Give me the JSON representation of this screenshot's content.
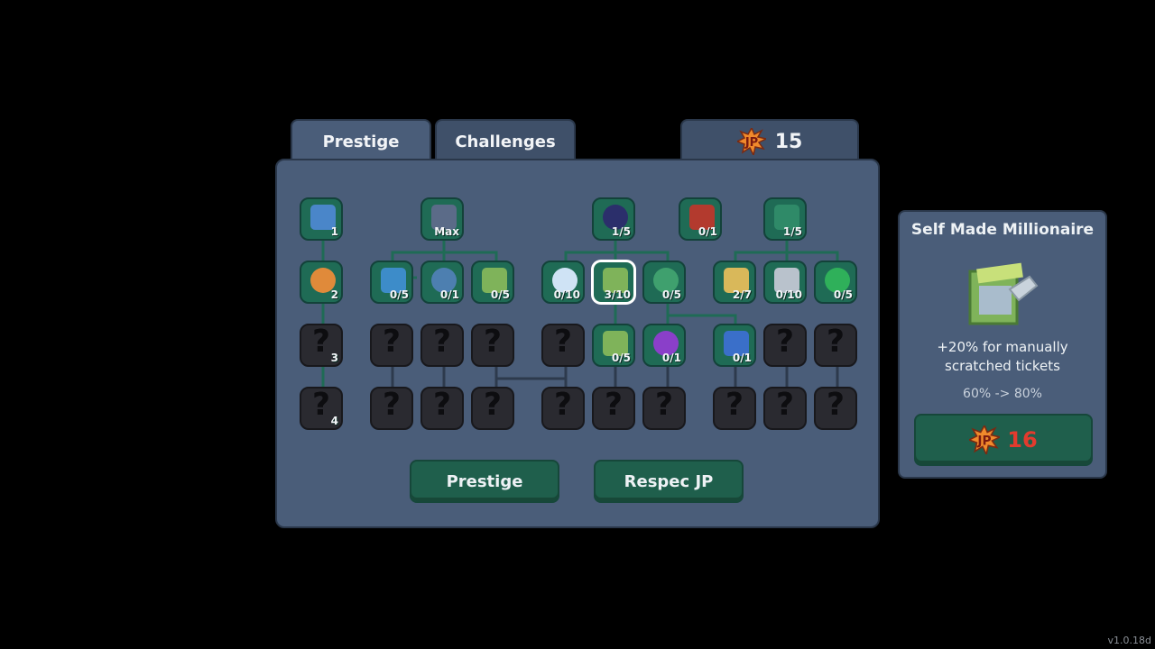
{
  "tabs": [
    {
      "label": "Prestige",
      "active": true
    },
    {
      "label": "Challenges",
      "active": false
    }
  ],
  "currency": {
    "icon": "jp-icon",
    "amount": "15"
  },
  "tree": {
    "columns": [
      {
        "name": "col-1",
        "nodes": [
          {
            "kind": "unlocked",
            "icon": "ticket-upgrade-icon",
            "level": "1"
          },
          {
            "kind": "unlocked",
            "icon": "clock-upgrade-icon",
            "level": "2"
          },
          {
            "kind": "locked",
            "level": "3"
          },
          {
            "kind": "locked",
            "level": "4"
          }
        ]
      },
      {
        "name": "col-2",
        "nodes": [
          {
            "kind": "unlocked",
            "icon": "robot-icon",
            "level": "Max"
          },
          {
            "kind": "unlocked",
            "icon": "energy-icon",
            "level": "0/5"
          },
          {
            "kind": "unlocked",
            "icon": "globe-icon",
            "level": "0/1"
          },
          {
            "kind": "unlocked",
            "icon": "ticket-win-icon",
            "level": "0/5"
          }
        ]
      },
      {
        "name": "col-3",
        "nodes": [
          {
            "kind": "unlocked",
            "icon": "night-island-icon",
            "level": "1/5"
          },
          {
            "kind": "unlocked",
            "icon": "moon-icon",
            "level": "0/10"
          },
          {
            "kind": "unlocked",
            "icon": "scratch-ticket-icon",
            "level": "3/10"
          },
          {
            "kind": "unlocked",
            "icon": "question-coin-icon",
            "level": "0/5"
          },
          {
            "kind": "unlocked",
            "icon": "ticket-auto-icon",
            "level": "0/5"
          },
          {
            "kind": "unlocked",
            "icon": "magic-star-icon",
            "level": "0/1"
          }
        ]
      },
      {
        "name": "col-4",
        "nodes": [
          {
            "kind": "unlocked",
            "icon": "shop-icon",
            "level": "0/1"
          },
          {
            "kind": "unlocked",
            "icon": "jp-sparkle-icon",
            "level": "1/5"
          },
          {
            "kind": "unlocked",
            "icon": "jackpot-icon",
            "level": "2/7"
          },
          {
            "kind": "unlocked",
            "icon": "coins-icon",
            "level": "0/10"
          },
          {
            "kind": "unlocked",
            "icon": "refresh-icon",
            "level": "0/5"
          },
          {
            "kind": "unlocked",
            "icon": "loot-bag-icon",
            "level": "0/1"
          }
        ]
      }
    ]
  },
  "buttons": {
    "prestige": "Prestige",
    "respec": "Respec JP"
  },
  "detail": {
    "title": "Self Made Millionaire",
    "icon": "scratch-ticket-icon",
    "description_line1": "+20% for manually",
    "description_line2": "scratched tickets",
    "change": "60% -> 80%",
    "cost": "16",
    "cost_icon": "jp-icon"
  },
  "version": "v1.0.18d",
  "colors": {
    "panel": "#4a5d79",
    "panel_border": "#2a374a",
    "node_unlocked": "#1f6b55",
    "node_locked": "#2a2a30",
    "button": "#1f5f4c",
    "cost_text": "#e23b2e"
  }
}
